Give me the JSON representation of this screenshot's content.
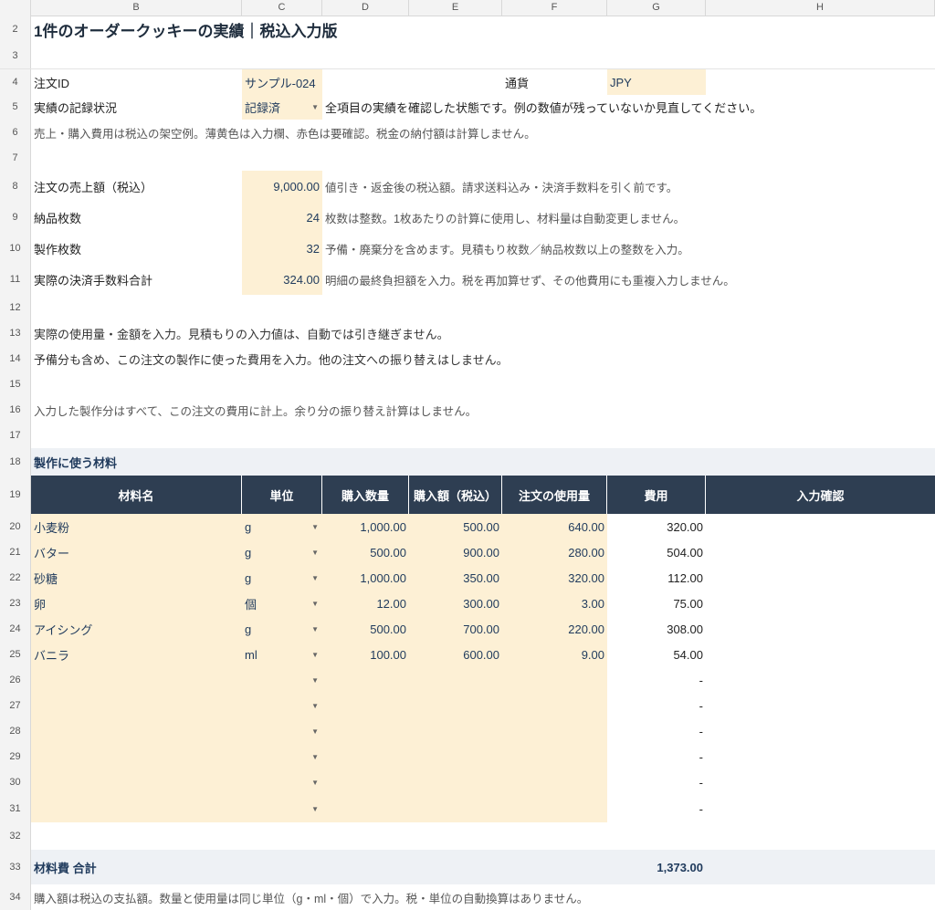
{
  "columns": [
    "B",
    "C",
    "D",
    "E",
    "F",
    "G",
    "H"
  ],
  "title": "1件のオーダークッキーの実績｜税込入力版",
  "order": {
    "id_label": "注文ID",
    "id_value": "サンプル-024",
    "currency_label": "通貨",
    "currency_value": "JPY",
    "status_label": "実績の記録状況",
    "status_value": "記録済",
    "status_note": "全項目の実績を確認した状態です。例の数値が残っていないか見直してください。",
    "legend_note": "売上・購入費用は税込の架空例。薄黄色は入力欄、赤色は要確認。税金の納付額は計算しません。"
  },
  "metrics": [
    {
      "label": "注文の売上額（税込）",
      "value": "9,000.00",
      "note": "値引き・返金後の税込額。請求送料込み・決済手数料を引く前です。"
    },
    {
      "label": "納品枚数",
      "value": "24",
      "note": "枚数は整数。1枚あたりの計算に使用し、材料量は自動変更しません。"
    },
    {
      "label": "製作枚数",
      "value": "32",
      "note": "予備・廃棄分を含めます。見積もり枚数／納品枚数以上の整数を入力。"
    },
    {
      "label": "実際の決済手数料合計",
      "value": "324.00",
      "note": "明細の最終負担額を入力。税を再加算せず、その他費用にも重複入力しません。"
    }
  ],
  "notes": {
    "r13": "実際の使用量・金額を入力。見積もりの入力値は、自動では引き継ぎません。",
    "r14": "予備分も含め、この注文の製作に使った費用を入力。他の注文への振り替えはしません。",
    "r16": "入力した製作分はすべて、この注文の費用に計上。余り分の振り替え計算はしません。",
    "r34": "購入額は税込の支払額。数量と使用量は同じ単位（g・ml・個）で入力。税・単位の自動換算はありません。"
  },
  "materials_section": "製作に使う材料",
  "table_headers": [
    "材料名",
    "単位",
    "購入数量",
    "購入額（税込）",
    "注文の使用量",
    "費用",
    "入力確認"
  ],
  "materials": [
    {
      "name": "小麦粉",
      "unit": "g",
      "qty": "1,000.00",
      "price": "500.00",
      "use": "640.00",
      "cost": "320.00"
    },
    {
      "name": "バター",
      "unit": "g",
      "qty": "500.00",
      "price": "900.00",
      "use": "280.00",
      "cost": "504.00"
    },
    {
      "name": "砂糖",
      "unit": "g",
      "qty": "1,000.00",
      "price": "350.00",
      "use": "320.00",
      "cost": "112.00"
    },
    {
      "name": "卵",
      "unit": "個",
      "qty": "12.00",
      "price": "300.00",
      "use": "3.00",
      "cost": "75.00"
    },
    {
      "name": "アイシング",
      "unit": "g",
      "qty": "500.00",
      "price": "700.00",
      "use": "220.00",
      "cost": "308.00"
    },
    {
      "name": "バニラ",
      "unit": "ml",
      "qty": "100.00",
      "price": "600.00",
      "use": "9.00",
      "cost": "54.00"
    },
    {
      "name": "",
      "unit": "",
      "qty": "",
      "price": "",
      "use": "",
      "cost": "-"
    },
    {
      "name": "",
      "unit": "",
      "qty": "",
      "price": "",
      "use": "",
      "cost": "-"
    },
    {
      "name": "",
      "unit": "",
      "qty": "",
      "price": "",
      "use": "",
      "cost": "-"
    },
    {
      "name": "",
      "unit": "",
      "qty": "",
      "price": "",
      "use": "",
      "cost": "-"
    },
    {
      "name": "",
      "unit": "",
      "qty": "",
      "price": "",
      "use": "",
      "cost": "-"
    },
    {
      "name": "",
      "unit": "",
      "qty": "",
      "price": "",
      "use": "",
      "cost": "-"
    }
  ],
  "total_label": "材料費 合計",
  "total_value": "1,373.00",
  "dropdown_glyph": "▼",
  "colors": {
    "input_fill": "#fdf0d5",
    "header_bg": "#2e3e52",
    "section_bg": "#eef1f5"
  }
}
